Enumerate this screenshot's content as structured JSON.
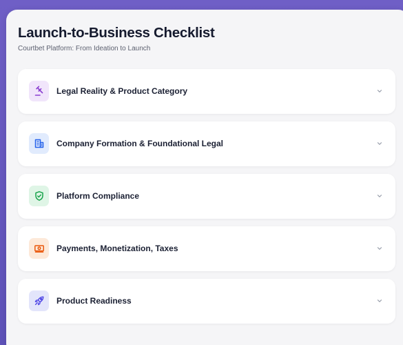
{
  "header": {
    "title": "Launch-to-Business Checklist",
    "subtitle": "Courtbet Platform: From Ideation to Launch"
  },
  "sections": [
    {
      "label": "Legal Reality & Product Category",
      "icon": "gavel-icon",
      "icon_color": "#8b3fd1",
      "icon_bg": "#f1e5fb"
    },
    {
      "label": "Company Formation & Foundational Legal",
      "icon": "building-icon",
      "icon_color": "#2563eb",
      "icon_bg": "#e1ebfd"
    },
    {
      "label": "Platform Compliance",
      "icon": "shield-check-icon",
      "icon_color": "#16a34a",
      "icon_bg": "#dff5e6"
    },
    {
      "label": "Payments, Monetization, Taxes",
      "icon": "money-icon",
      "icon_color": "#ea580c",
      "icon_bg": "#fde9d9"
    },
    {
      "label": "Product Readiness",
      "icon": "rocket-icon",
      "icon_color": "#4f46e5",
      "icon_bg": "#e3e5fb"
    }
  ],
  "colors": {
    "background": "#6f5fc6",
    "card": "#f5f5f7",
    "chevron": "#9aa0ad"
  }
}
